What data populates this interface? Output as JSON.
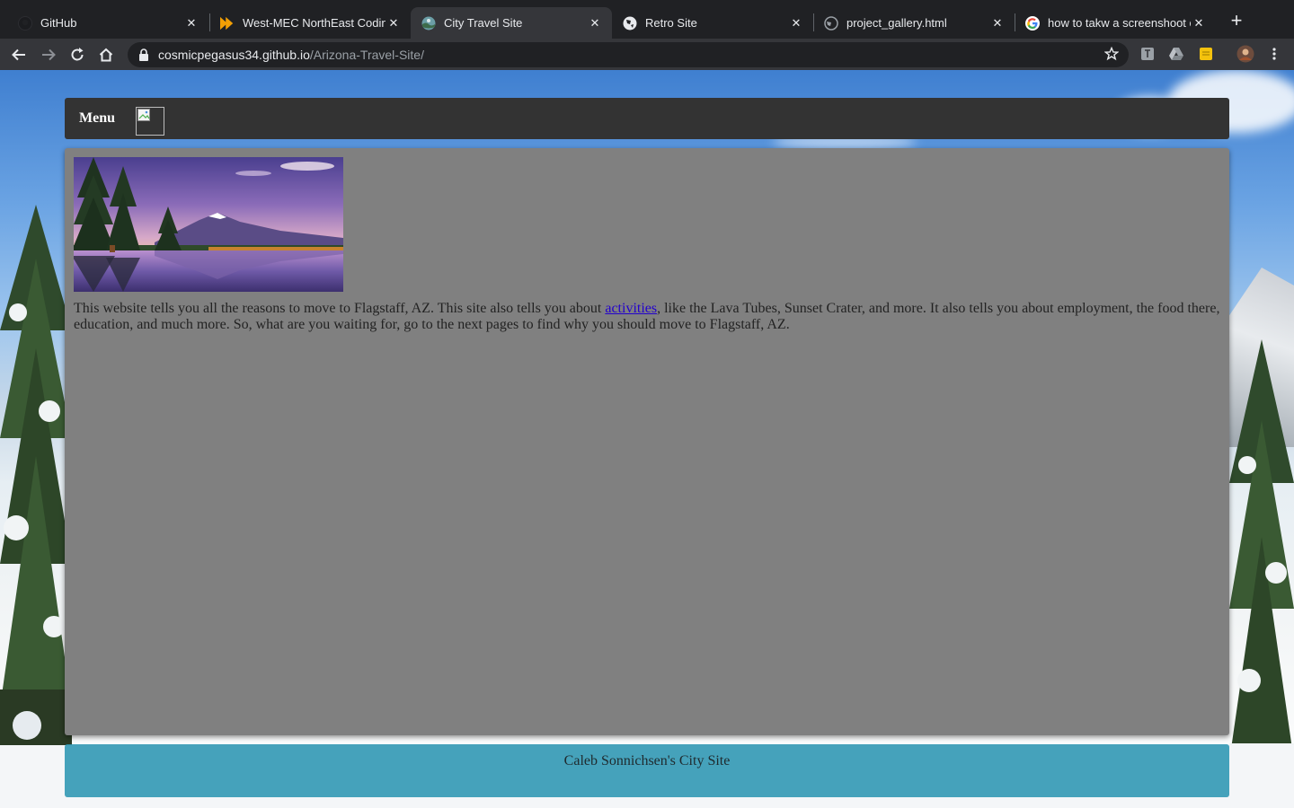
{
  "browser": {
    "tabs": [
      {
        "title": "GitHub",
        "icon": "github-icon"
      },
      {
        "title": "West-MEC NorthEast Coding",
        "icon": "play-arrows-icon"
      },
      {
        "title": "City Travel Site",
        "icon": "globe-icon",
        "active": true
      },
      {
        "title": "Retro Site",
        "icon": "globe-icon"
      },
      {
        "title": "project_gallery.html",
        "icon": "globe-icon"
      },
      {
        "title": "how to takw a screenshoot on",
        "icon": "google-icon"
      }
    ],
    "address": {
      "host": "cosmicpegasus34.github.io",
      "path": "/Arizona-Travel-Site/"
    }
  },
  "page": {
    "menu_label": "Menu",
    "intro": {
      "before": "This website tells you all the reasons to move to Flagstaff, AZ. This site also tells you about ",
      "link": "activities",
      "after": ", like the Lava Tubes, Sunset Crater, and more. It also tells you about employment, the food there, education, and much more. So, what are you waiting for, go to the next pages to find why you should move to Flagstaff, AZ."
    },
    "footer": "Caleb Sonnichsen's City Site"
  },
  "colors": {
    "menubar": "#333333",
    "content_panel": "#808080",
    "footer": "#2c96b2",
    "link": "#2200cc"
  }
}
